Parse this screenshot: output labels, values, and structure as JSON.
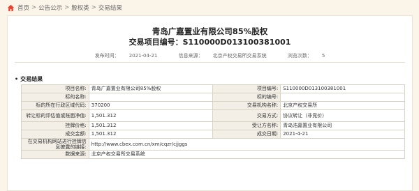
{
  "breadcrumb": {
    "items": [
      "首页",
      "公告公示",
      "股权类",
      "交易结果"
    ],
    "separator": ">"
  },
  "header": {
    "title": "青岛广嘉置业有限公司85%股权",
    "code_label": "交易项目编号：",
    "code_value": "S110000D013100381001"
  },
  "meta": {
    "publish_label": "发布时间：",
    "publish_value": "2021-04-21",
    "source_label": "信息来源：",
    "source_value": "北京产权交易所交易系统",
    "views_label": "浏览次数：",
    "views_value": "5"
  },
  "section": {
    "title": "交易结果"
  },
  "table": {
    "rows": [
      {
        "l1": "项目名称:",
        "v1": "青岛广嘉置业有限公司85%股权",
        "l2": "项目编号:",
        "v2": "S110000D013100381001"
      },
      {
        "l1": "标的名称:",
        "v1": "",
        "l2": "标的编号:",
        "v2": ""
      },
      {
        "l1": "标的所在行政区域代码:",
        "v1": "370200",
        "l2": "交易机构名称:",
        "v2": "北京产权交易所"
      },
      {
        "l1": "转让标的评估值或账面净值:",
        "v1": "1,501.312",
        "l2": "交易方式:",
        "v2": "协议转让（非竞价）"
      },
      {
        "l1": "挂牌价格:",
        "v1": "1,501.312",
        "l2": "受让方名称:",
        "v2": "青岛浩嘉置业有限公司"
      },
      {
        "l1": "成交金额:",
        "v1": "1,501.312",
        "l2": "成交日期:",
        "v2": "2021-4-21"
      }
    ],
    "link_label": "在交易机构网站进行挂牌信息披露的链接:",
    "link_value": "http://www.cbex.com.cn/xm/cqzr/cjjggs",
    "source_label": "数据来源:",
    "source_value": "北京产权交易所交易系统"
  },
  "colors": {
    "page_bg": "#fbf4e9",
    "home_icon": "#e8412c"
  }
}
